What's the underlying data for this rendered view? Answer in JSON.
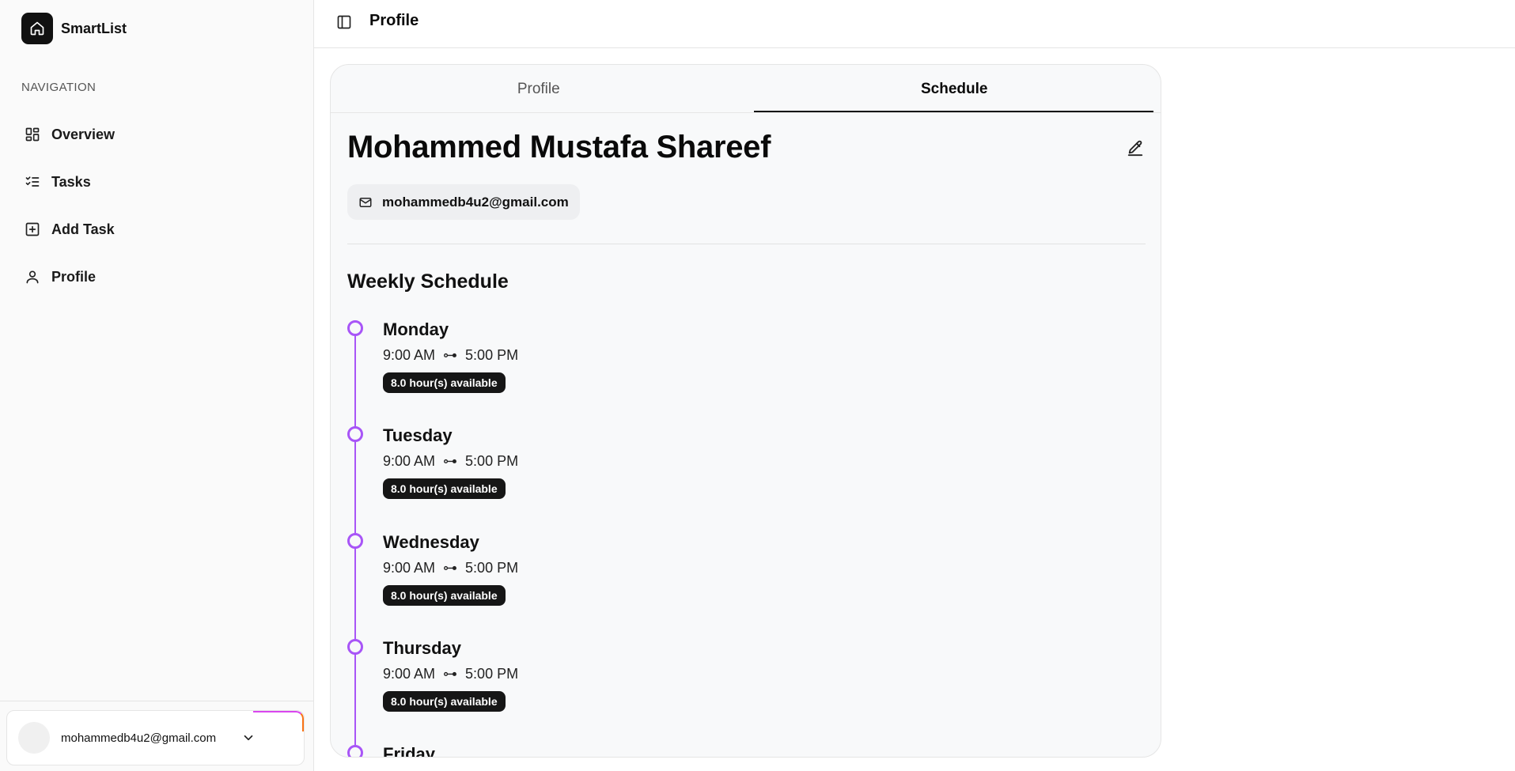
{
  "app": {
    "name": "SmartList"
  },
  "sidebar": {
    "nav_heading": "NAVIGATION",
    "items": [
      {
        "label": "Overview",
        "icon": "layout-grid-icon"
      },
      {
        "label": "Tasks",
        "icon": "list-checks-icon"
      },
      {
        "label": "Add Task",
        "icon": "plus-square-icon"
      },
      {
        "label": "Profile",
        "icon": "user-icon"
      }
    ],
    "user": {
      "email": "mohammedb4u2@gmail.com"
    }
  },
  "header": {
    "title": "Profile"
  },
  "tabs": [
    {
      "label": "Profile",
      "active": false
    },
    {
      "label": "Schedule",
      "active": true
    }
  ],
  "profile": {
    "name": "Mohammed Mustafa Shareef",
    "email": "mohammedb4u2@gmail.com"
  },
  "schedule": {
    "title": "Weekly Schedule",
    "arrow": "⊶",
    "days": [
      {
        "name": "Monday",
        "start": "9:00 AM",
        "end": "5:00 PM",
        "available": "8.0 hour(s) available"
      },
      {
        "name": "Tuesday",
        "start": "9:00 AM",
        "end": "5:00 PM",
        "available": "8.0 hour(s) available"
      },
      {
        "name": "Wednesday",
        "start": "9:00 AM",
        "end": "5:00 PM",
        "available": "8.0 hour(s) available"
      },
      {
        "name": "Thursday",
        "start": "9:00 AM",
        "end": "5:00 PM",
        "available": "8.0 hour(s) available"
      },
      {
        "name": "Friday"
      }
    ]
  },
  "colors": {
    "accent": "#a855f7",
    "dark": "#111111"
  }
}
